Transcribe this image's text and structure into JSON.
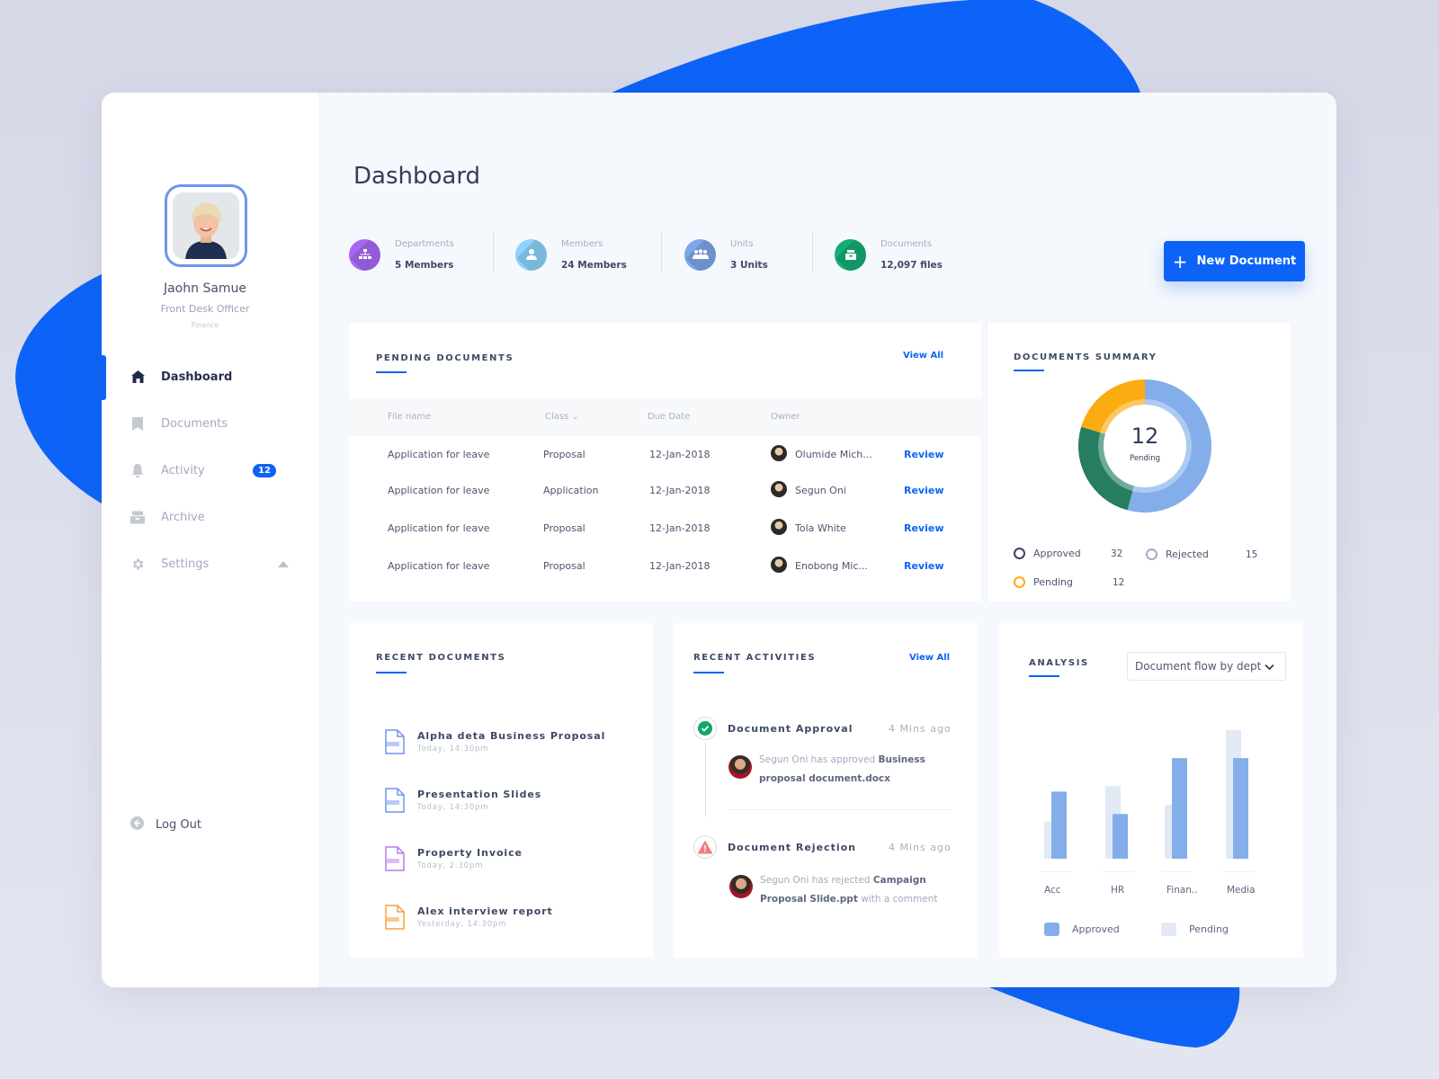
{
  "colors": {
    "accent": "#0d63f7",
    "approved": "#83aeea",
    "pending_bar": "#e1e9f5",
    "donut_approved": "#83aeea",
    "donut_rejected": "#267d5f",
    "donut_pending": "#fcab10"
  },
  "profile": {
    "name": "Jaohn Samue",
    "role": "Front Desk Officer",
    "department": "Finance"
  },
  "sidebar": {
    "items": [
      {
        "label": "Dashboard",
        "icon": "home-icon",
        "active": true
      },
      {
        "label": "Documents",
        "icon": "bookmark-icon"
      },
      {
        "label": "Activity",
        "icon": "bell-icon",
        "badge": "12"
      },
      {
        "label": "Archive",
        "icon": "archive-icon"
      },
      {
        "label": "Settings",
        "icon": "gear-icon"
      }
    ],
    "logout_label": "Log Out"
  },
  "header": {
    "title": "Dashboard",
    "new_document_label": "New Document"
  },
  "stats": [
    {
      "label": "Departments",
      "value": "5 Members",
      "icon": "org-chart-icon",
      "color": "#a769f5"
    },
    {
      "label": "Members",
      "value": "24 Members",
      "icon": "user-icon",
      "color": "#8dd3fc"
    },
    {
      "label": "Units",
      "value": "3 Units",
      "icon": "group-icon",
      "color": "#7ea7ea"
    },
    {
      "label": "Documents",
      "value": "12,097 files",
      "icon": "inbox-icon",
      "color": "#13ae74"
    }
  ],
  "pending_documents": {
    "title": "PENDING DOCUMENTS",
    "view_all": "View All",
    "columns": [
      "File name",
      "Class",
      "Due Date",
      "Owner"
    ],
    "rows": [
      {
        "file": "Application for leave",
        "class": "Proposal",
        "due": "12-Jan-2018",
        "owner": "Olumide Mich...",
        "action": "Review"
      },
      {
        "file": "Application for leave",
        "class": "Application",
        "due": "12-Jan-2018",
        "owner": "Segun Oni",
        "action": "Review"
      },
      {
        "file": "Application for leave",
        "class": "Proposal",
        "due": "12-Jan-2018",
        "owner": "Tola White",
        "action": "Review"
      },
      {
        "file": "Application for leave",
        "class": "Proposal",
        "due": "12-Jan-2018",
        "owner": "Enobong Mic...",
        "action": "Review"
      }
    ]
  },
  "documents_summary": {
    "title": "DOCUMENTS SUMMARY",
    "center_value": "12",
    "center_label": "Pending",
    "legend": [
      {
        "label": "Approved",
        "value": "32",
        "ring": "#3d3f63"
      },
      {
        "label": "Rejected",
        "value": "15",
        "ring": "#a6adbf"
      },
      {
        "label": "Pending",
        "value": "12",
        "ring": "#fcab10"
      }
    ]
  },
  "recent_documents": {
    "title": "RECENT DOCUMENTS",
    "items": [
      {
        "name": "Alpha deta Business Proposal",
        "time": "Today, 14:30pm",
        "color": "#6e95ee"
      },
      {
        "name": "Presentation Slides",
        "time": "Today, 14:30pm",
        "color": "#6e95ee"
      },
      {
        "name": "Property Invoice",
        "time": "Today, 2:30pm",
        "color": "#b878f0"
      },
      {
        "name": "Alex interview report",
        "time": "Yesterday, 14:30pm",
        "color": "#f7a23c"
      }
    ]
  },
  "recent_activities": {
    "title": "RECENT ACTIVITIES",
    "view_all": "View All",
    "items": [
      {
        "type": "approval",
        "heading": "Document Approval",
        "time": "4 Mins ago",
        "actor": "Segun Oni",
        "verb": "has approved",
        "object": "Business proposal document.docx",
        "suffix": ""
      },
      {
        "type": "rejection",
        "heading": "Document Rejection",
        "time": "4 Mins ago",
        "actor": "Segun Oni",
        "verb": "has rejected",
        "object": "Campaign Proposal Slide.ppt",
        "suffix": "with a comment"
      }
    ]
  },
  "analysis": {
    "title": "ANALYSIS",
    "dropdown_value": "Document flow by dept"
  },
  "chart_data": [
    {
      "type": "pie",
      "title": "DOCUMENTS SUMMARY",
      "categories": [
        "Approved",
        "Rejected",
        "Pending"
      ],
      "values": [
        32,
        15,
        12
      ],
      "center_text": "12 Pending"
    },
    {
      "type": "bar",
      "title": "Document flow by dept",
      "categories": [
        "Acc",
        "HR",
        "Finan..",
        "Media"
      ],
      "series": [
        {
          "name": "Pending",
          "values": [
            40,
            78,
            58,
            138
          ]
        },
        {
          "name": "Approved",
          "values": [
            72,
            48,
            108,
            108
          ]
        }
      ],
      "ylim": [
        0,
        140
      ],
      "grid": false,
      "legend": "bottom"
    }
  ]
}
